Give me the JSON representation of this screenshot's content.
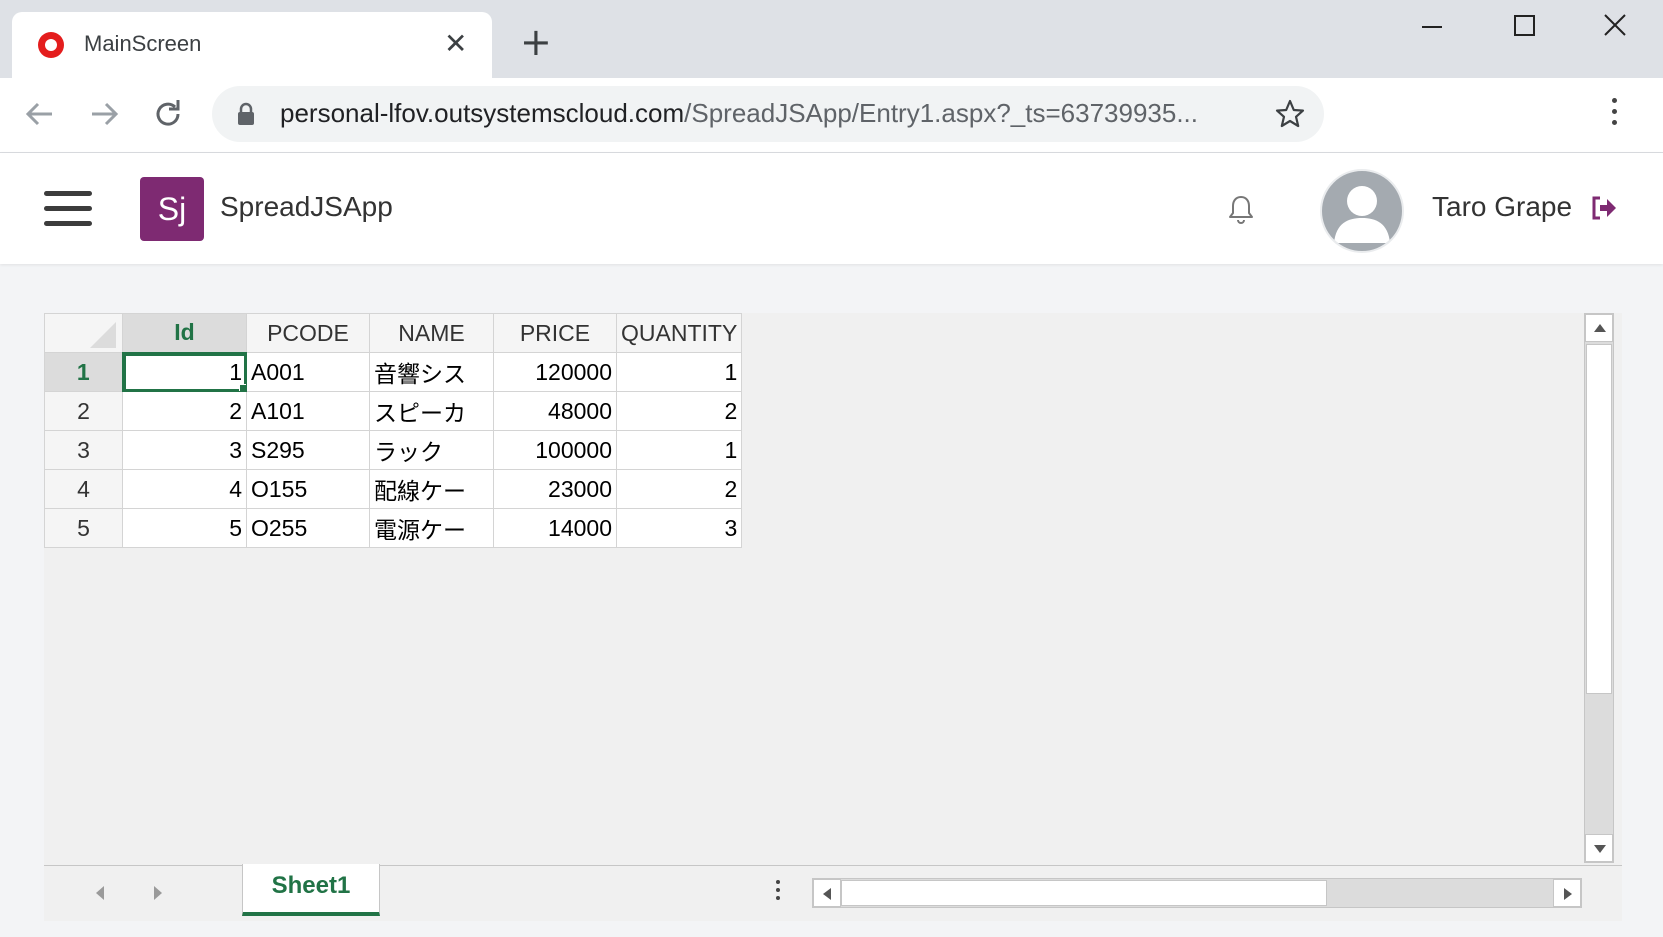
{
  "browser": {
    "tab_title": "MainScreen",
    "tab_close": "✕",
    "new_tab": "+",
    "url_host": "personal-lfov.outsystemscloud.com",
    "url_path": "/SpreadJSApp/Entry1.aspx?_ts=63739935...",
    "favicon_color": "#e41d1d"
  },
  "app": {
    "logo_text": "Sj",
    "name": "SpreadJSApp",
    "user_name": "Taro Grape",
    "brand_color": "#7e2a72"
  },
  "spreadsheet": {
    "columns": [
      "Id",
      "PCODE",
      "NAME",
      "PRICE",
      "QUANTITY"
    ],
    "row_headers": [
      "1",
      "2",
      "3",
      "4",
      "5"
    ],
    "rows": [
      [
        "1",
        "A001",
        "音響シス",
        "120000",
        "1"
      ],
      [
        "2",
        "A101",
        "スピーカ",
        "48000",
        "2"
      ],
      [
        "3",
        "S295",
        "ラック",
        "100000",
        "1"
      ],
      [
        "4",
        "O155",
        "配線ケー",
        "23000",
        "2"
      ],
      [
        "5",
        "O255",
        "電源ケー",
        "14000",
        "3"
      ]
    ],
    "sheet_tab": "Sheet1",
    "accent_color": "#217346"
  }
}
